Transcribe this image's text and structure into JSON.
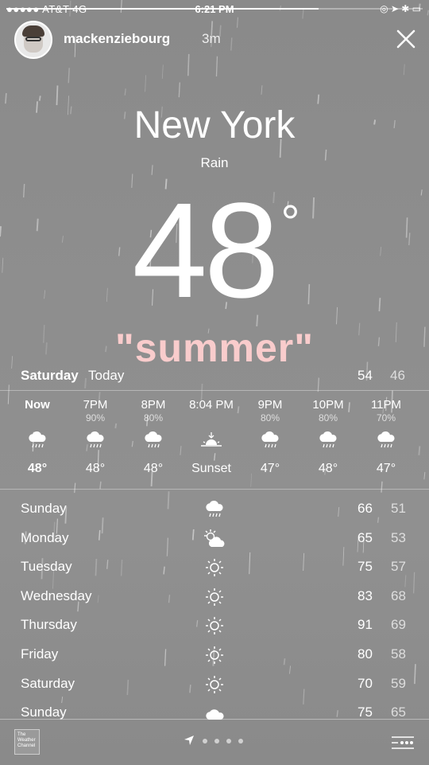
{
  "status_bar": {
    "carrier": "●●●●● AT&T 4G",
    "time": "6:21 PM",
    "indicators": "◎ ➤ ✱ ▭"
  },
  "story": {
    "username": "mackenziebourg",
    "time_ago": "3m",
    "progress": 0.75
  },
  "weather": {
    "city": "New York",
    "condition": "Rain",
    "temperature": "48",
    "degree_symbol": "°",
    "caption": "\"summer\"",
    "today": {
      "day": "Saturday",
      "label": "Today",
      "high": "54",
      "low": "46"
    },
    "hourly": [
      {
        "time": "Now",
        "pct": "",
        "icon": "rain-cloud-icon",
        "temp": "48°"
      },
      {
        "time": "7PM",
        "pct": "90%",
        "icon": "rain-cloud-icon",
        "temp": "48°"
      },
      {
        "time": "8PM",
        "pct": "80%",
        "icon": "rain-cloud-icon",
        "temp": "48°"
      },
      {
        "time": "8:04 PM",
        "pct": "",
        "icon": "sunset-icon",
        "temp": "Sunset"
      },
      {
        "time": "9PM",
        "pct": "80%",
        "icon": "rain-cloud-icon",
        "temp": "47°"
      },
      {
        "time": "10PM",
        "pct": "80%",
        "icon": "rain-cloud-icon",
        "temp": "48°"
      },
      {
        "time": "11PM",
        "pct": "70%",
        "icon": "rain-cloud-icon",
        "temp": "47°"
      }
    ],
    "daily": [
      {
        "day": "Sunday",
        "icon": "rain-cloud-icon",
        "high": "66",
        "low": "51"
      },
      {
        "day": "Monday",
        "icon": "partly-cloudy-icon",
        "high": "65",
        "low": "53"
      },
      {
        "day": "Tuesday",
        "icon": "sun-icon",
        "high": "75",
        "low": "57"
      },
      {
        "day": "Wednesday",
        "icon": "sun-icon",
        "high": "83",
        "low": "68"
      },
      {
        "day": "Thursday",
        "icon": "sun-icon",
        "high": "91",
        "low": "69"
      },
      {
        "day": "Friday",
        "icon": "sun-icon",
        "high": "80",
        "low": "58"
      },
      {
        "day": "Saturday",
        "icon": "sun-icon",
        "high": "70",
        "low": "59"
      },
      {
        "day": "Sunday",
        "icon": "cloud-icon",
        "high": "75",
        "low": "65"
      }
    ]
  },
  "bottom_bar": {
    "logo_text": "The Weather Channel",
    "page_count": 4
  },
  "colors": {
    "background": "#8e8e8e",
    "caption": "#f9cccc",
    "text": "#ffffff"
  }
}
